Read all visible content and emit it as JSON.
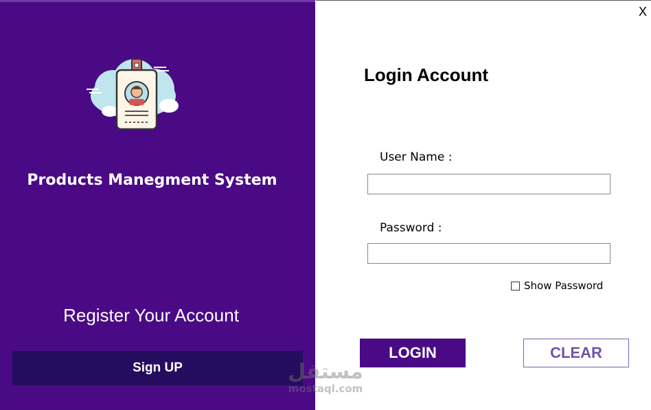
{
  "app": {
    "title": "Products Manegment System"
  },
  "left_panel": {
    "register_text": "Register Your Account",
    "signup_label": "Sign UP",
    "logo_icon": "id-badge-icon",
    "background_color": "#4a0a86"
  },
  "window": {
    "close_label": "X"
  },
  "login": {
    "title": "Login Account",
    "username_label": "User Name :",
    "username_value": "",
    "password_label": "Password :",
    "password_value": "",
    "show_password_label": "Show Password",
    "show_password_checked": false,
    "login_label": "LOGIN",
    "clear_label": "CLEAR"
  },
  "watermark": {
    "arabic": "مستقل",
    "latin": "mostaql.com"
  }
}
